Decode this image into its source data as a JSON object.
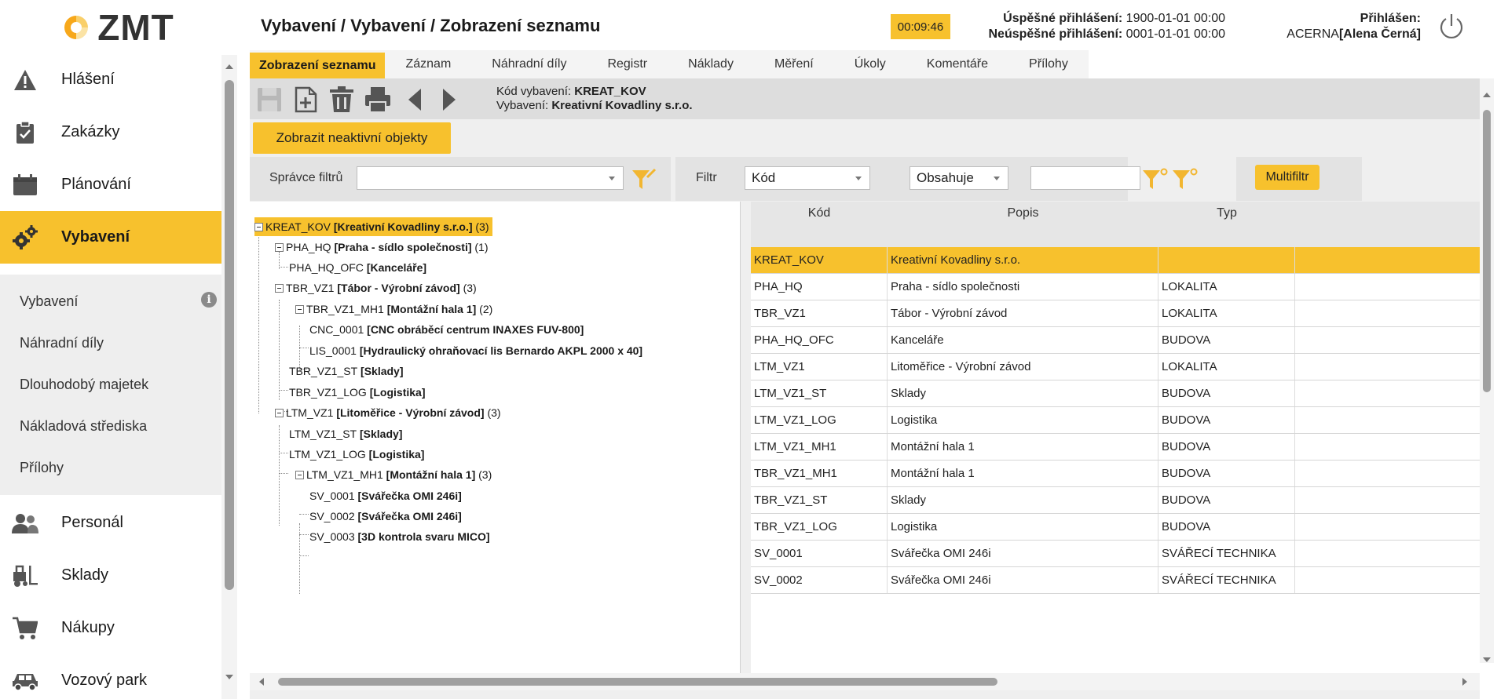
{
  "app": {
    "logo_text": "ZMT",
    "brand_color": "#f7c12d"
  },
  "header": {
    "title": "Vybavení / Vybavení / Zobrazení seznamu",
    "timer": "00:09:46",
    "success_login_label": "Úspěšné přihlášení:",
    "success_login_value": "1900-01-01 00:00",
    "failed_login_label": "Neúspěšné přihlášení:",
    "failed_login_value": "0001-01-01 00:00",
    "logged_in_label": "Přihlášen:",
    "logged_in_org": "ACERNA",
    "logged_in_user": "[Alena Černá]"
  },
  "sidebar": {
    "top_items": [
      {
        "label": "Hlášení",
        "icon": "warning-icon"
      },
      {
        "label": "Zakázky",
        "icon": "clipboard-icon"
      },
      {
        "label": "Plánování",
        "icon": "calendar-icon"
      },
      {
        "label": "Vybavení",
        "icon": "gears-icon"
      }
    ],
    "sub_items": [
      "Vybavení",
      "Náhradní díly",
      "Dlouhodobý majetek",
      "Nákladová střediska",
      "Přílohy"
    ],
    "bottom_items": [
      {
        "label": "Personál",
        "icon": "people-icon"
      },
      {
        "label": "Sklady",
        "icon": "forklift-icon"
      },
      {
        "label": "Nákupy",
        "icon": "cart-icon"
      },
      {
        "label": "Vozový park",
        "icon": "car-icon"
      }
    ]
  },
  "tabs": [
    "Zobrazení seznamu",
    "Záznam",
    "Náhradní díly",
    "Registr",
    "Náklady",
    "Měření",
    "Úkoly",
    "Komentáře",
    "Přílohy"
  ],
  "record": {
    "code_label": "Kód vybavení:",
    "code_value": "KREAT_KOV",
    "equipment_label": "Vybavení:",
    "equipment_value": "Kreativní Kovadliny s.r.o."
  },
  "buttons": {
    "show_inactive": "Zobrazit neaktivní objekty",
    "multifilter": "Multifiltr"
  },
  "filters": {
    "manager_label": "Správce filtrů",
    "manager_value": "",
    "filter_label": "Filtr",
    "field_value": "Kód",
    "operator_value": "Obsahuje",
    "text_value": ""
  },
  "tree": [
    {
      "code": "KREAT_KOV",
      "name": "[Kreativní Kovadliny s.r.o.]",
      "count": "(3)"
    },
    {
      "code": "PHA_HQ",
      "name": "[Praha - sídlo společnosti]",
      "count": "(1)"
    },
    {
      "code": "PHA_HQ_OFC",
      "name": "[Kanceláře]",
      "count": ""
    },
    {
      "code": "TBR_VZ1",
      "name": "[Tábor - Výrobní závod]",
      "count": "(3)"
    },
    {
      "code": "TBR_VZ1_MH1",
      "name": "[Montážní hala 1]",
      "count": "(2)"
    },
    {
      "code": "CNC_0001",
      "name": "[CNC obráběcí centrum INAXES FUV-800]",
      "count": ""
    },
    {
      "code": "LIS_0001",
      "name": "[Hydraulický ohraňovací lis Bernardo AKPL 2000 x 40]",
      "count": ""
    },
    {
      "code": "TBR_VZ1_ST",
      "name": "[Sklady]",
      "count": ""
    },
    {
      "code": "TBR_VZ1_LOG",
      "name": "[Logistika]",
      "count": ""
    },
    {
      "code": "LTM_VZ1",
      "name": "[Litoměřice - Výrobní závod]",
      "count": "(3)"
    },
    {
      "code": "LTM_VZ1_ST",
      "name": "[Sklady]",
      "count": ""
    },
    {
      "code": "LTM_VZ1_LOG",
      "name": "[Logistika]",
      "count": ""
    },
    {
      "code": "LTM_VZ1_MH1",
      "name": "[Montážní hala 1]",
      "count": "(3)"
    },
    {
      "code": "SV_0001",
      "name": "[Svářečka OMI 246i]",
      "count": ""
    },
    {
      "code": "SV_0002",
      "name": "[Svářečka OMI 246i]",
      "count": ""
    },
    {
      "code": "SV_0003",
      "name": "[3D kontrola svaru MICO]",
      "count": ""
    }
  ],
  "grid": {
    "columns": [
      "Kód",
      "Popis",
      "Typ"
    ],
    "rows": [
      [
        "KREAT_KOV",
        "Kreativní Kovadliny s.r.o.",
        ""
      ],
      [
        "PHA_HQ",
        "Praha - sídlo společnosti",
        "LOKALITA"
      ],
      [
        "TBR_VZ1",
        "Tábor - Výrobní závod",
        "LOKALITA"
      ],
      [
        "PHA_HQ_OFC",
        "Kanceláře",
        "BUDOVA"
      ],
      [
        "LTM_VZ1",
        "Litoměřice - Výrobní závod",
        "LOKALITA"
      ],
      [
        "LTM_VZ1_ST",
        "Sklady",
        "BUDOVA"
      ],
      [
        "LTM_VZ1_LOG",
        "Logistika",
        "BUDOVA"
      ],
      [
        "LTM_VZ1_MH1",
        "Montážní hala 1",
        "BUDOVA"
      ],
      [
        "TBR_VZ1_MH1",
        "Montážní hala 1",
        "BUDOVA"
      ],
      [
        "TBR_VZ1_ST",
        "Sklady",
        "BUDOVA"
      ],
      [
        "TBR_VZ1_LOG",
        "Logistika",
        "BUDOVA"
      ],
      [
        "SV_0001",
        "Svářečka OMI 246i",
        "SVÁŘECÍ TECHNIKA"
      ],
      [
        "SV_0002",
        "Svářečka OMI 246i",
        "SVÁŘECÍ TECHNIKA"
      ]
    ]
  }
}
